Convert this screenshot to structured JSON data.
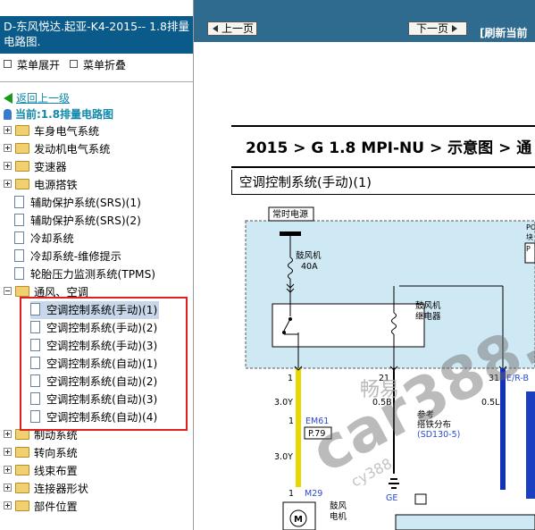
{
  "sidebar": {
    "title": "D-东风悦达.起亚-K4-2015-- 1.8排量电路图.",
    "expand_menu": "菜单展开",
    "collapse_menu": "菜单折叠",
    "back": "返回上一级",
    "current": "当前:1.8排量电路图",
    "items": [
      {
        "label": "车身电气系统",
        "kind": "folder"
      },
      {
        "label": "发动机电气系统",
        "kind": "folder"
      },
      {
        "label": "变速器",
        "kind": "folder"
      },
      {
        "label": "电源搭铁",
        "kind": "folder"
      },
      {
        "label": "辅助保护系统(SRS)(1)",
        "kind": "doc"
      },
      {
        "label": "辅助保护系统(SRS)(2)",
        "kind": "doc"
      },
      {
        "label": "冷却系统",
        "kind": "doc"
      },
      {
        "label": "冷却系统-维修提示",
        "kind": "doc"
      },
      {
        "label": "轮胎压力监测系统(TPMS)",
        "kind": "doc"
      },
      {
        "label": "通风、空调",
        "kind": "folder-open"
      },
      {
        "label": "空调控制系统(手动)(1)",
        "kind": "doc",
        "selected": true
      },
      {
        "label": "空调控制系统(手动)(2)",
        "kind": "doc"
      },
      {
        "label": "空调控制系统(手动)(3)",
        "kind": "doc"
      },
      {
        "label": "空调控制系统(自动)(1)",
        "kind": "doc"
      },
      {
        "label": "空调控制系统(自动)(2)",
        "kind": "doc"
      },
      {
        "label": "空调控制系统(自动)(3)",
        "kind": "doc"
      },
      {
        "label": "空调控制系统(自动)(4)",
        "kind": "doc"
      },
      {
        "label": "制动系统",
        "kind": "folder"
      },
      {
        "label": "转向系统",
        "kind": "folder"
      },
      {
        "label": "线束布置",
        "kind": "folder"
      },
      {
        "label": "连接器形状",
        "kind": "folder"
      },
      {
        "label": "部件位置",
        "kind": "folder"
      }
    ]
  },
  "viewer": {
    "prev": "上一页",
    "next": "下一页",
    "refresh": "[刷新当前",
    "breadcrumb": "2015 > G 1.8 MPI-NU > 示意图 > 通",
    "diagram_title": "空调控制系统(手动)(1)",
    "diagram": {
      "power_label": "常时电源",
      "fuse_name": "鼓风机",
      "fuse_rating": "40A",
      "relay_name_1": "鼓风机",
      "relay_name_2": "继电器",
      "pin_1": "1",
      "pin_21": "21",
      "pin_31": "31",
      "wire_3_0y_a": "3.0Y",
      "wire_0_5b": "0.5B",
      "wire_0_5l": "0.5L",
      "wire_er_b": "E/R-B",
      "conn_em61": "EM61",
      "ref_p79": "P.79",
      "ground_ref_1": "参考",
      "ground_ref_2": "搭铁分布",
      "ground_ref_3": "(SD130-5)",
      "wire_3_0y_b": "3.0Y",
      "conn_m29": "M29",
      "blower_motor_1": "鼓风",
      "blower_motor_2": "电机",
      "ground_ge": "GE",
      "corner_po": "PO",
      "corner_k": "块",
      "corner_p": "P"
    },
    "watermark": "畅易",
    "watermark_2": "car388.c",
    "watermark_3": "cy388"
  }
}
